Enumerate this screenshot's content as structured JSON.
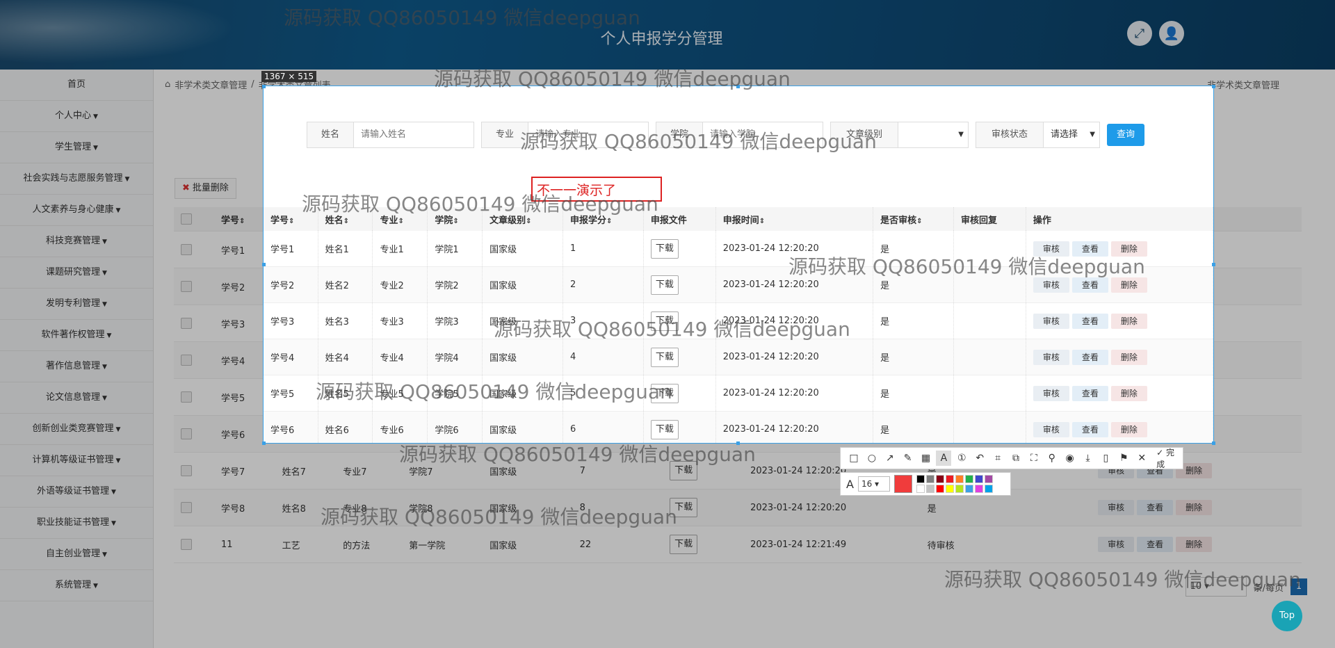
{
  "header": {
    "title": "个人申报学分管理"
  },
  "sidebar": {
    "items": [
      {
        "label": "首页",
        "caret": false
      },
      {
        "label": "个人中心",
        "caret": true
      },
      {
        "label": "学生管理",
        "caret": true
      },
      {
        "label": "社会实践与志愿服务管理",
        "caret": true
      },
      {
        "label": "人文素养与身心健康",
        "caret": true
      },
      {
        "label": "科技竞赛管理",
        "caret": true
      },
      {
        "label": "课题研究管理",
        "caret": true
      },
      {
        "label": "发明专利管理",
        "caret": true
      },
      {
        "label": "软件著作权管理",
        "caret": true
      },
      {
        "label": "著作信息管理",
        "caret": true
      },
      {
        "label": "论文信息管理",
        "caret": true
      },
      {
        "label": "创新创业类竞赛管理",
        "caret": true
      },
      {
        "label": "计算机等级证书管理",
        "caret": true
      },
      {
        "label": "外语等级证书管理",
        "caret": true
      },
      {
        "label": "职业技能证书管理",
        "caret": true
      },
      {
        "label": "自主创业管理",
        "caret": true
      },
      {
        "label": "系统管理",
        "caret": true
      }
    ]
  },
  "breadcrumb": {
    "parent": "非学术类文章管理",
    "sep": "/",
    "current": "非学术类文章列表",
    "right": "非学术类文章管理"
  },
  "capture": {
    "size_label": "1367 × 515",
    "annotation": "不一一演示了"
  },
  "search": {
    "name_label": "姓名",
    "name_placeholder": "请输入姓名",
    "major_label": "专业",
    "major_placeholder": "请输入专业",
    "college_label": "学院",
    "college_placeholder": "请输入学院",
    "level_label": "文章级别",
    "level_value": "",
    "status_label": "审核状态",
    "status_value": "请选择",
    "query_label": "查询"
  },
  "actions": {
    "batch_delete": "批量删除"
  },
  "table": {
    "headers": [
      "学号",
      "姓名",
      "专业",
      "学院",
      "文章级别",
      "申报学分",
      "申报文件",
      "申报时间",
      "是否审核",
      "审核回复",
      "操作"
    ],
    "sortable": [
      true,
      true,
      true,
      true,
      true,
      true,
      false,
      true,
      true,
      false,
      false
    ],
    "rows": [
      {
        "id": "学号1",
        "name": "姓名1",
        "major": "专业1",
        "college": "学院1",
        "level": "国家级",
        "credit": "1",
        "time": "2023-01-24 12:20:20",
        "audited": "是",
        "reply": ""
      },
      {
        "id": "学号2",
        "name": "姓名2",
        "major": "专业2",
        "college": "学院2",
        "level": "国家级",
        "credit": "2",
        "time": "2023-01-24 12:20:20",
        "audited": "是",
        "reply": ""
      },
      {
        "id": "学号3",
        "name": "姓名3",
        "major": "专业3",
        "college": "学院3",
        "level": "国家级",
        "credit": "3",
        "time": "2023-01-24 12:20:20",
        "audited": "是",
        "reply": ""
      },
      {
        "id": "学号4",
        "name": "姓名4",
        "major": "专业4",
        "college": "学院4",
        "level": "国家级",
        "credit": "4",
        "time": "2023-01-24 12:20:20",
        "audited": "是",
        "reply": ""
      },
      {
        "id": "学号5",
        "name": "姓名5",
        "major": "专业5",
        "college": "学院5",
        "level": "国家级",
        "credit": "5",
        "time": "2023-01-24 12:20:20",
        "audited": "是",
        "reply": ""
      },
      {
        "id": "学号6",
        "name": "姓名6",
        "major": "专业6",
        "college": "学院6",
        "level": "国家级",
        "credit": "6",
        "time": "2023-01-24 12:20:20",
        "audited": "是",
        "reply": ""
      },
      {
        "id": "学号7",
        "name": "姓名7",
        "major": "专业7",
        "college": "学院7",
        "level": "国家级",
        "credit": "7",
        "time": "2023-01-24 12:20:20",
        "audited": "是",
        "reply": ""
      },
      {
        "id": "学号8",
        "name": "姓名8",
        "major": "专业8",
        "college": "学院8",
        "level": "国家级",
        "credit": "8",
        "time": "2023-01-24 12:20:20",
        "audited": "是",
        "reply": ""
      },
      {
        "id": "11",
        "name": "工艺",
        "major": "的方法",
        "college": "第一学院",
        "level": "国家级",
        "credit": "22",
        "time": "2023-01-24 12:21:49",
        "audited": "待审核",
        "reply": ""
      }
    ],
    "download_label": "下载",
    "btn_audit": "审核",
    "btn_view": "查看",
    "btn_delete": "删除"
  },
  "pager": {
    "page_size": "10",
    "page": "1",
    "total_label": "条/每页"
  },
  "toolbar": {
    "font_size": "16",
    "done_label": "完成",
    "current_color": "#f03c3c",
    "palette": [
      "#000000",
      "#7f7f7f",
      "#880015",
      "#ed1c24",
      "#ff7f27",
      "#22b14c",
      "#3f48cc",
      "#a349a4",
      "#ffffff",
      "#c3c3c3",
      "#ff0000",
      "#ffff00",
      "#b5e61d",
      "#3ca0e6",
      "#e040e0",
      "#00a2e8"
    ]
  },
  "watermark": "源码获取 QQ86050149 微信deepguan",
  "top_button": "Top"
}
